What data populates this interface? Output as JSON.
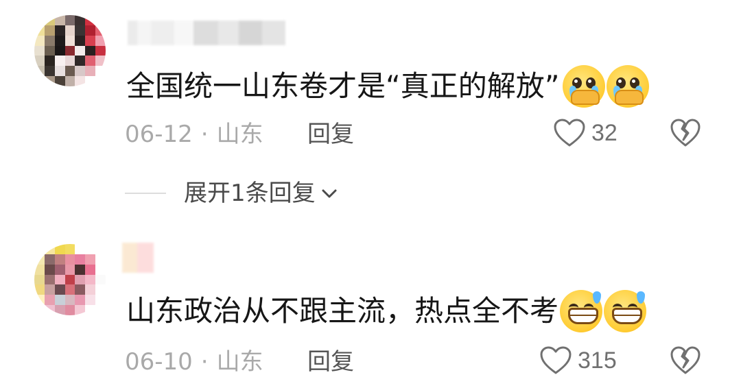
{
  "comments": [
    {
      "text": "全国统一山东卷才是“真正的解放”",
      "emojis": [
        "crying-hands-emoji",
        "crying-hands-emoji"
      ],
      "date": "06-12",
      "separator": "·",
      "location": "山东",
      "reply_label": "回复",
      "likes": "32",
      "expand_label": "展开1条回复"
    },
    {
      "text": "山东政治从不跟主流，热点全不考",
      "emojis": [
        "grinning-sweat-emoji",
        "grinning-sweat-emoji"
      ],
      "date": "06-10",
      "separator": "·",
      "location": "山东",
      "reply_label": "回复",
      "likes": "315"
    }
  ],
  "icons": {
    "like": "heart-outline-icon",
    "dislike": "broken-heart-icon",
    "expand": "chevron-down-icon"
  },
  "colors": {
    "text": "#161616",
    "meta": "#a9a9a9",
    "icon": "#707070"
  }
}
